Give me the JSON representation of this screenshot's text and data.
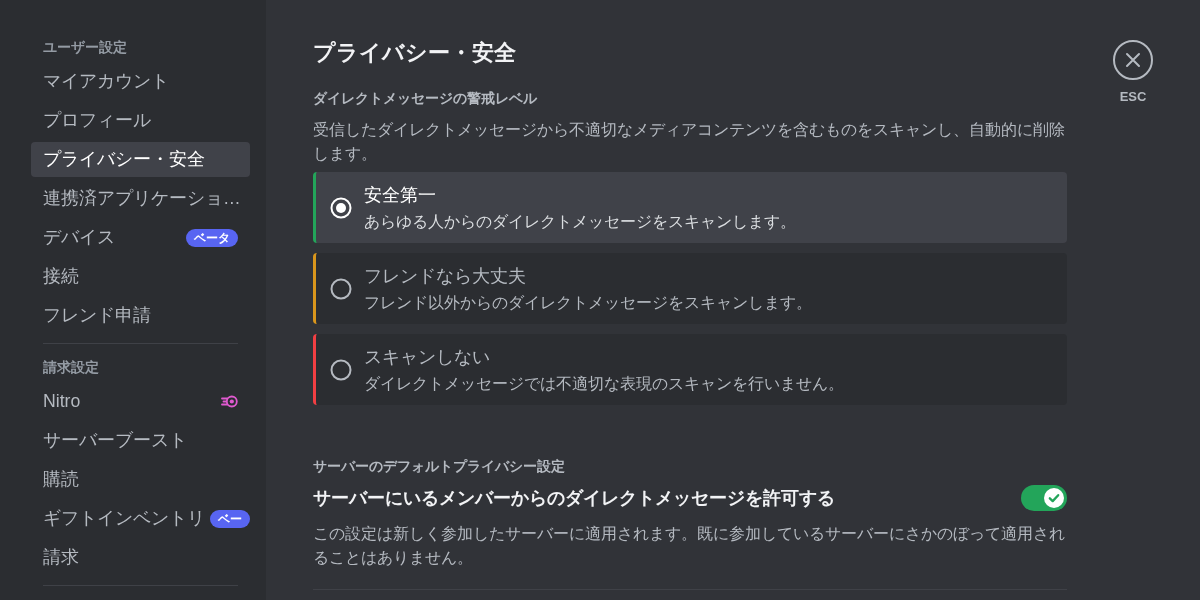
{
  "sidebar": {
    "sections": [
      {
        "header": "ユーザー設定",
        "items": [
          {
            "label": "マイアカウント",
            "kind": "plain",
            "selected": false
          },
          {
            "label": "プロフィール",
            "kind": "plain",
            "selected": false
          },
          {
            "label": "プライバシー・安全",
            "kind": "plain",
            "selected": true
          },
          {
            "label": "連携済アプリケーショ…",
            "kind": "plain",
            "selected": false
          },
          {
            "label": "デバイス",
            "kind": "badge",
            "badge": "ベータ",
            "selected": false
          },
          {
            "label": "接続",
            "kind": "plain",
            "selected": false
          },
          {
            "label": "フレンド申請",
            "kind": "plain",
            "selected": false
          }
        ]
      },
      {
        "header": "請求設定",
        "items": [
          {
            "label": "Nitro",
            "kind": "icon",
            "selected": false
          },
          {
            "label": "サーバーブースト",
            "kind": "plain",
            "selected": false
          },
          {
            "label": "購読",
            "kind": "plain",
            "selected": false
          },
          {
            "label": "ギフトインベントリ",
            "kind": "badge",
            "badge": "ベー",
            "selected": false
          },
          {
            "label": "請求",
            "kind": "plain",
            "selected": false
          }
        ]
      }
    ]
  },
  "main": {
    "title": "プライバシー・安全",
    "dm_filter": {
      "header": "ダイレクトメッセージの警戒レベル",
      "description": "受信したダイレクトメッセージから不適切なメディアコンテンツを含むものをスキャンし、自動的に削除します。",
      "options": [
        {
          "title": "安全第一",
          "description": "あらゆる人からのダイレクトメッセージをスキャンします。",
          "selected": true,
          "color": "#23a55a"
        },
        {
          "title": "フレンドなら大丈夫",
          "description": "フレンド以外からのダイレクトメッセージをスキャンします。",
          "selected": false,
          "color": "#d9961c"
        },
        {
          "title": "スキャンしない",
          "description": "ダイレクトメッセージでは不適切な表現のスキャンを行いません。",
          "selected": false,
          "color": "#f23f43"
        }
      ]
    },
    "server_defaults": {
      "header": "サーバーのデフォルトプライバシー設定",
      "setting": {
        "label": "サーバーにいるメンバーからのダイレクトメッセージを許可する",
        "on": true,
        "description": "この設定は新しく参加したサーバーに適用されます。既に参加しているサーバーにさかのぼって適用されることはありません。"
      }
    }
  },
  "close": {
    "label": "ESC"
  }
}
